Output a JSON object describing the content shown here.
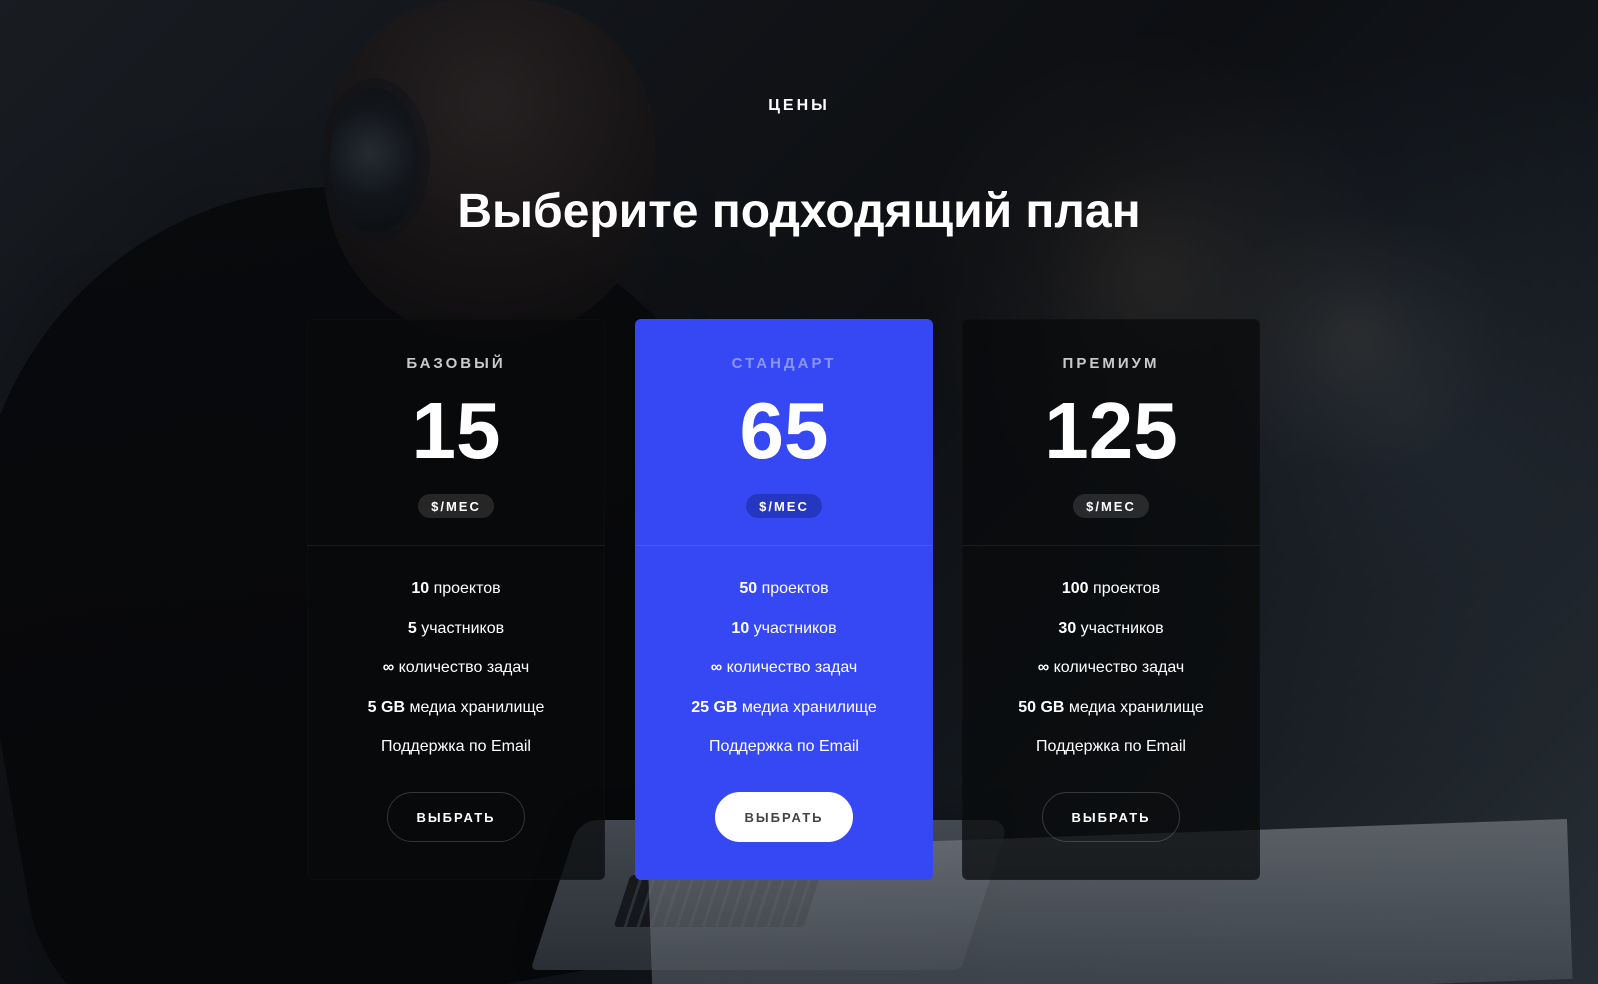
{
  "section": {
    "eyebrow": "ЦЕНЫ",
    "title": "Выберите подходящий план"
  },
  "plans": [
    {
      "name": "БАЗОВЫЙ",
      "price": "15",
      "period": "$/МЕС",
      "features": [
        {
          "prefix": "",
          "emphasis": "10",
          "text": " проектов"
        },
        {
          "prefix": "",
          "emphasis": "5",
          "text": " участников"
        },
        {
          "prefix": "",
          "emphasis": "∞",
          "text": " количество задач"
        },
        {
          "prefix": "",
          "emphasis": "5 GB",
          "text": " медиа хранилище"
        },
        {
          "prefix": "Поддержка по Email",
          "emphasis": "",
          "text": ""
        }
      ],
      "button_label": "ВЫБРАТЬ"
    },
    {
      "name": "СТАНДАРТ",
      "price": "65",
      "period": "$/МЕС",
      "features": [
        {
          "prefix": "",
          "emphasis": "50",
          "text": " проектов"
        },
        {
          "prefix": "",
          "emphasis": "10",
          "text": " участников"
        },
        {
          "prefix": "",
          "emphasis": "∞",
          "text": " количество задач"
        },
        {
          "prefix": "",
          "emphasis": "25 GB",
          "text": " медиа хранилище"
        },
        {
          "prefix": "Поддержка по Email",
          "emphasis": "",
          "text": ""
        }
      ],
      "button_label": "ВЫБРАТЬ"
    },
    {
      "name": "ПРЕМИУМ",
      "price": "125",
      "period": "$/МЕС",
      "features": [
        {
          "prefix": "",
          "emphasis": "100",
          "text": " проектов"
        },
        {
          "prefix": "",
          "emphasis": "30",
          "text": " участников"
        },
        {
          "prefix": "",
          "emphasis": "∞",
          "text": " количество задач"
        },
        {
          "prefix": "",
          "emphasis": "50 GB",
          "text": " медиа хранилище"
        },
        {
          "prefix": "Поддержка по Email",
          "emphasis": "",
          "text": ""
        }
      ],
      "button_label": "ВЫБРАТЬ"
    }
  ],
  "colors": {
    "featured": "#3548f4",
    "text": "#ffffff",
    "dark_card": "#08090b"
  }
}
